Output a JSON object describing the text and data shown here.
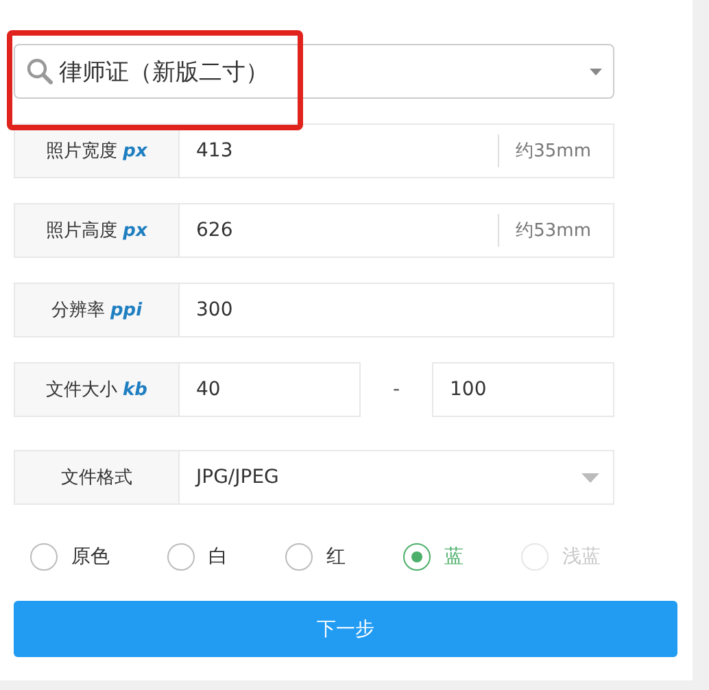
{
  "template_select": {
    "value": "律师证（新版二寸）",
    "highlighted": true
  },
  "fields": [
    {
      "kind": "single",
      "label": "照片宽度",
      "unit": "px",
      "value": "413",
      "suffix": "约35mm"
    },
    {
      "kind": "single",
      "label": "照片高度",
      "unit": "px",
      "value": "626",
      "suffix": "约53mm"
    },
    {
      "kind": "single",
      "label": "分辨率",
      "unit": "ppi",
      "value": "300"
    },
    {
      "kind": "range",
      "label": "文件大小",
      "unit": "kb",
      "value": "40",
      "separator": "-",
      "value_max": "100"
    },
    {
      "kind": "select",
      "label": "文件格式",
      "value": "JPG/JPEG"
    }
  ],
  "background_colors": [
    {
      "label": "原色",
      "selected": false,
      "disabled": false
    },
    {
      "label": "白",
      "selected": false,
      "disabled": false
    },
    {
      "label": "红",
      "selected": false,
      "disabled": false
    },
    {
      "label": "蓝",
      "selected": true,
      "disabled": false
    },
    {
      "label": "浅蓝",
      "selected": false,
      "disabled": true
    }
  ],
  "next_button": "下一步"
}
